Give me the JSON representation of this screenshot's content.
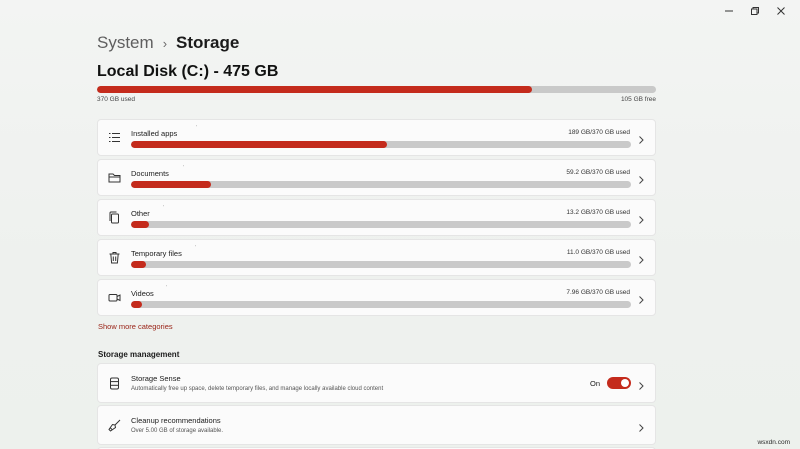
{
  "window": {
    "controls": [
      "minimize-icon",
      "maximize-icon",
      "close-icon"
    ]
  },
  "breadcrumb": {
    "parent": "System",
    "separator": "›",
    "current": "Storage"
  },
  "disk": {
    "title": "Local Disk (C:) - 475 GB",
    "used_label": "370 GB used",
    "free_label": "105 GB free",
    "used_fraction": 0.779
  },
  "categories": [
    {
      "label": "Installed apps",
      "size": "189 GB/370 GB used",
      "icon": "apps-list-icon",
      "fraction": 0.511
    },
    {
      "label": "Documents",
      "size": "59.2 GB/370 GB used",
      "icon": "folder-icon",
      "fraction": 0.16
    },
    {
      "label": "Other",
      "size": "13.2 GB/370 GB used",
      "icon": "copy-icon",
      "fraction": 0.036
    },
    {
      "label": "Temporary files",
      "size": "11.0 GB/370 GB used",
      "icon": "trash-icon",
      "fraction": 0.03
    },
    {
      "label": "Videos",
      "size": "7.96 GB/370 GB used",
      "icon": "video-icon",
      "fraction": 0.022
    }
  ],
  "show_more": "Show more categories",
  "storage_management": {
    "heading": "Storage management",
    "storage_sense": {
      "title": "Storage Sense",
      "subtitle": "Automatically free up space, delete temporary files, and manage locally available cloud content",
      "toggle_label": "On",
      "toggle_on": true,
      "icon": "storage-drive-icon"
    },
    "cleanup": {
      "title": "Cleanup recommendations",
      "subtitle": "Over 5.00 GB of storage available.",
      "icon": "broom-icon"
    }
  },
  "watermark": "wsxdn.com",
  "colors": {
    "accent": "#c42b1c",
    "track": "#c9c9c9",
    "card": "#fbfbfb"
  }
}
